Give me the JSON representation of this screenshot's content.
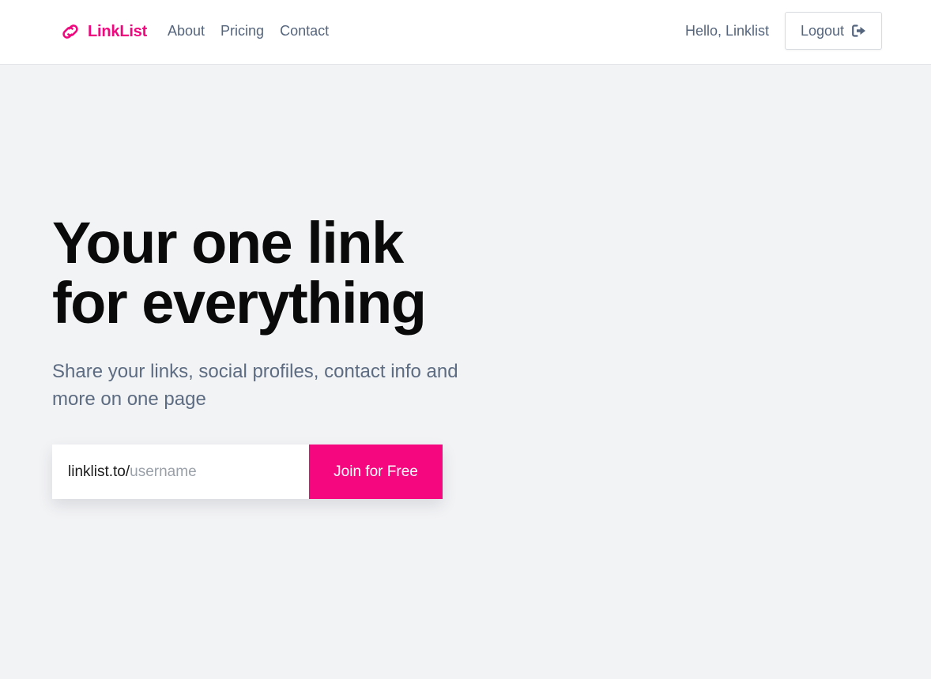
{
  "colors": {
    "brand": "#f0087e",
    "button": "#f5087f",
    "nav_text": "#55657d",
    "background": "#f2f3f5"
  },
  "nav": {
    "brand_text": "LinkList",
    "brand_icon": "chain-link-icon",
    "links": [
      "About",
      "Pricing",
      "Contact"
    ],
    "greeting": "Hello, Linklist",
    "logout_label": "Logout",
    "logout_icon": "sign-out-icon"
  },
  "hero": {
    "title_line1": "Your one link",
    "title_line2": "for everything",
    "subtitle": "Share your links, social profiles, contact info and more on one page"
  },
  "signup": {
    "url_prefix": "linklist.to/",
    "username_placeholder": "username",
    "username_value": "",
    "join_label": "Join for Free"
  }
}
